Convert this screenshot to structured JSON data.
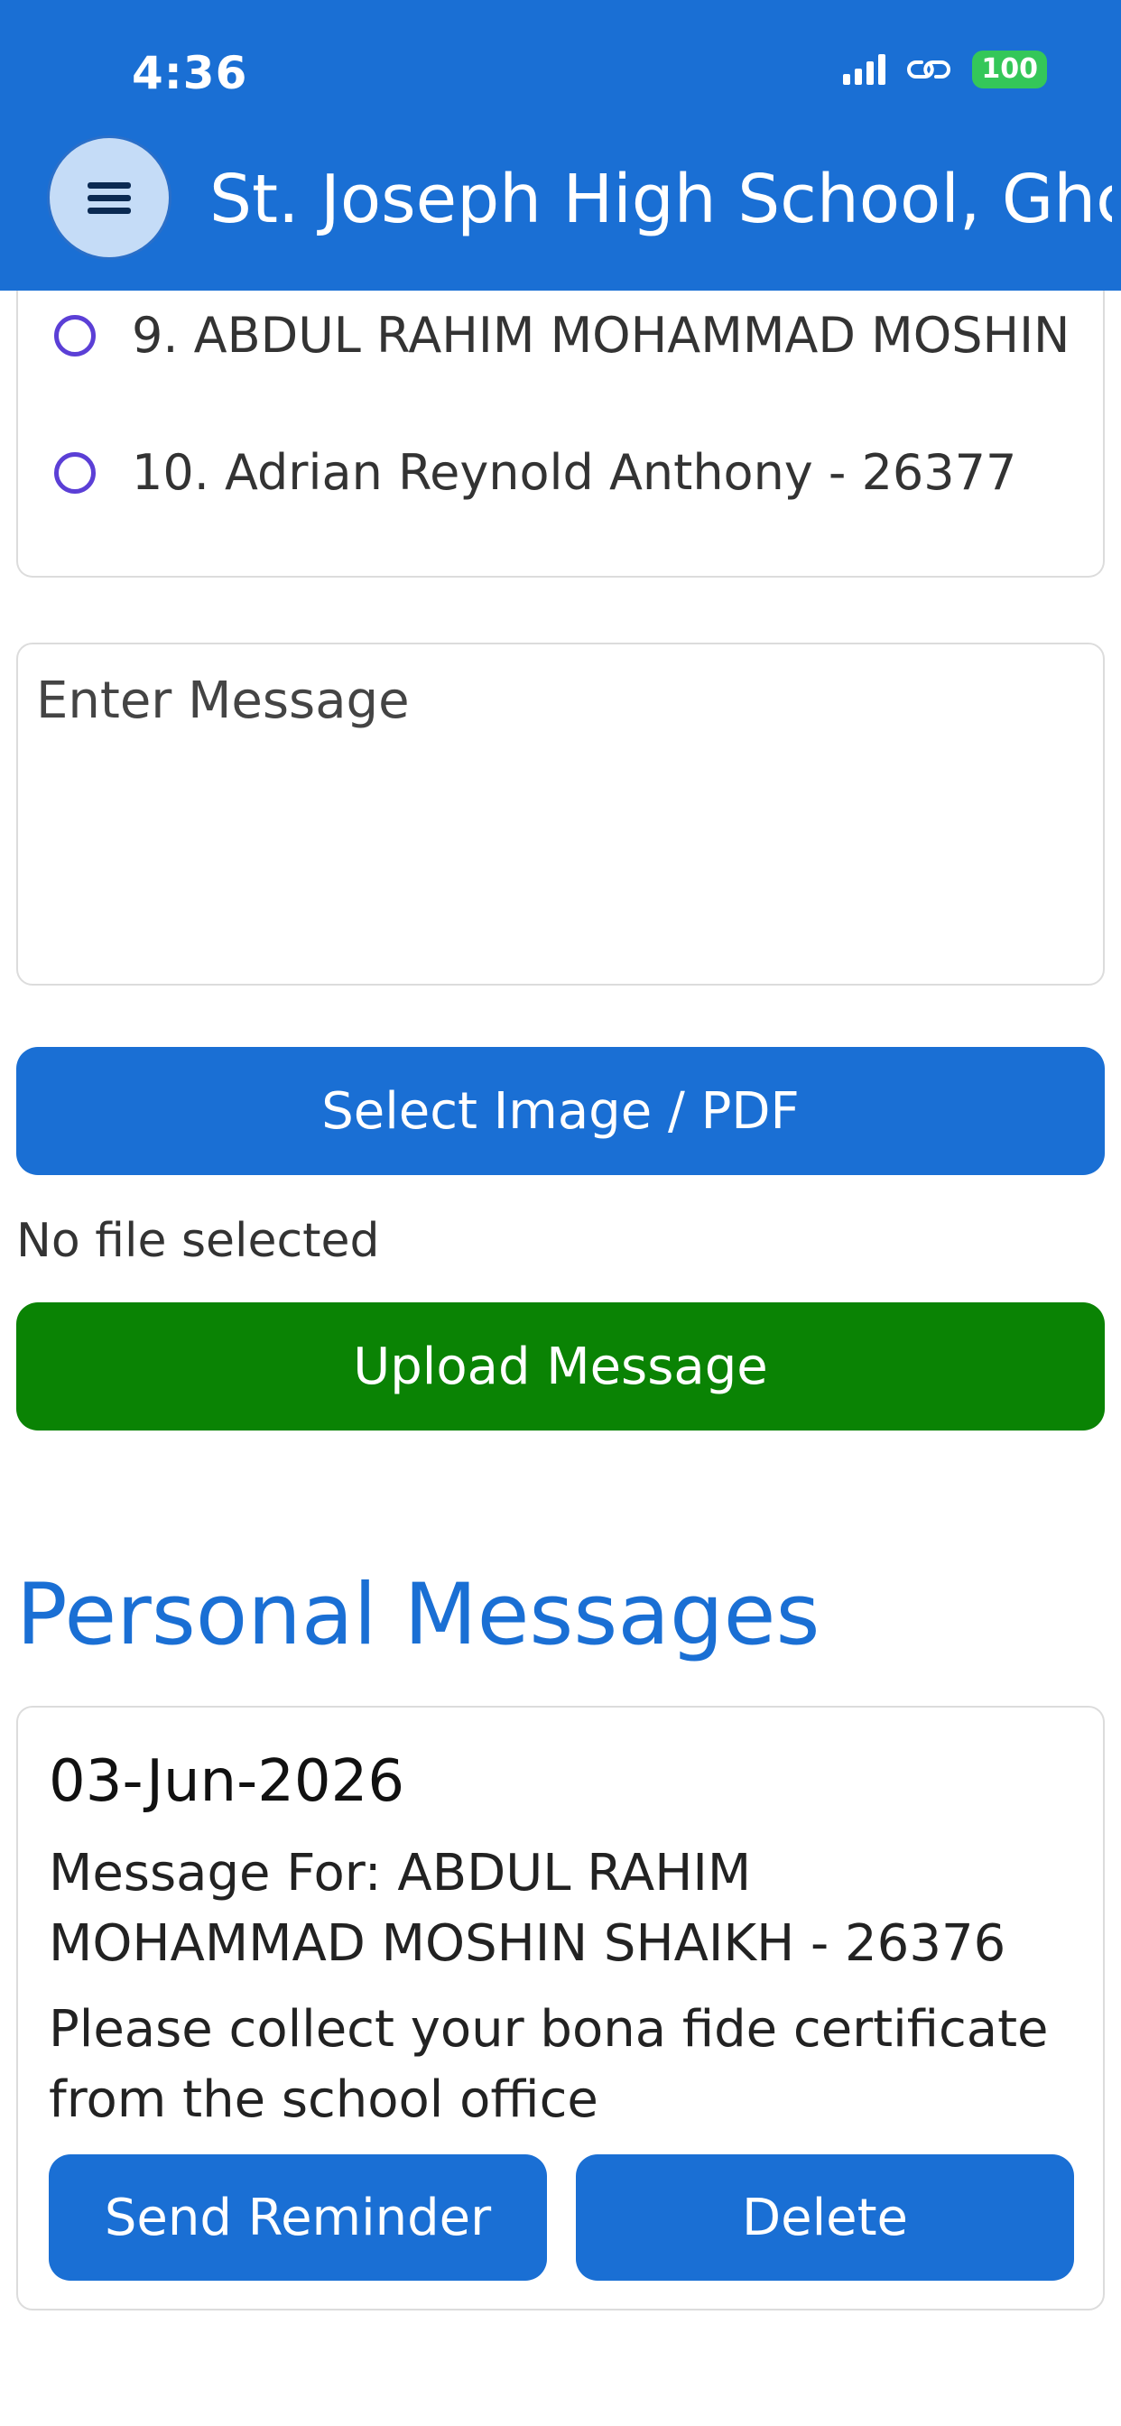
{
  "status_bar": {
    "time": "4:36",
    "battery": "100"
  },
  "header": {
    "title": "St. Joseph High School, Ghc"
  },
  "student_list": {
    "items": [
      {
        "label": "9. ABDUL RAHIM MOHAMMAD MOSHIN"
      },
      {
        "label": "10. Adrian Reynold Anthony - 26377"
      }
    ]
  },
  "message_input": {
    "placeholder": "Enter Message",
    "value": ""
  },
  "file_picker": {
    "button_label": "Select Image / PDF",
    "status": "No file selected"
  },
  "upload": {
    "button_label": "Upload Message"
  },
  "personal_messages": {
    "title": "Personal Messages",
    "items": [
      {
        "date": "03-Jun-2026",
        "recipient": "Message For: ABDUL RAHIM MOHAMMAD MOSHIN SHAIKH - 26376",
        "body": "Please collect your bona fide certificate from the school office",
        "reminder_label": "Send Reminder",
        "delete_label": "Delete"
      }
    ]
  },
  "colors": {
    "primary": "#1a6fd4",
    "upload_green": "#0a8304",
    "radio": "#5b3fd6",
    "battery": "#34c759"
  },
  "icons": [
    "signal-icon",
    "link-icon",
    "battery-icon",
    "menu-icon",
    "radio-icon"
  ]
}
